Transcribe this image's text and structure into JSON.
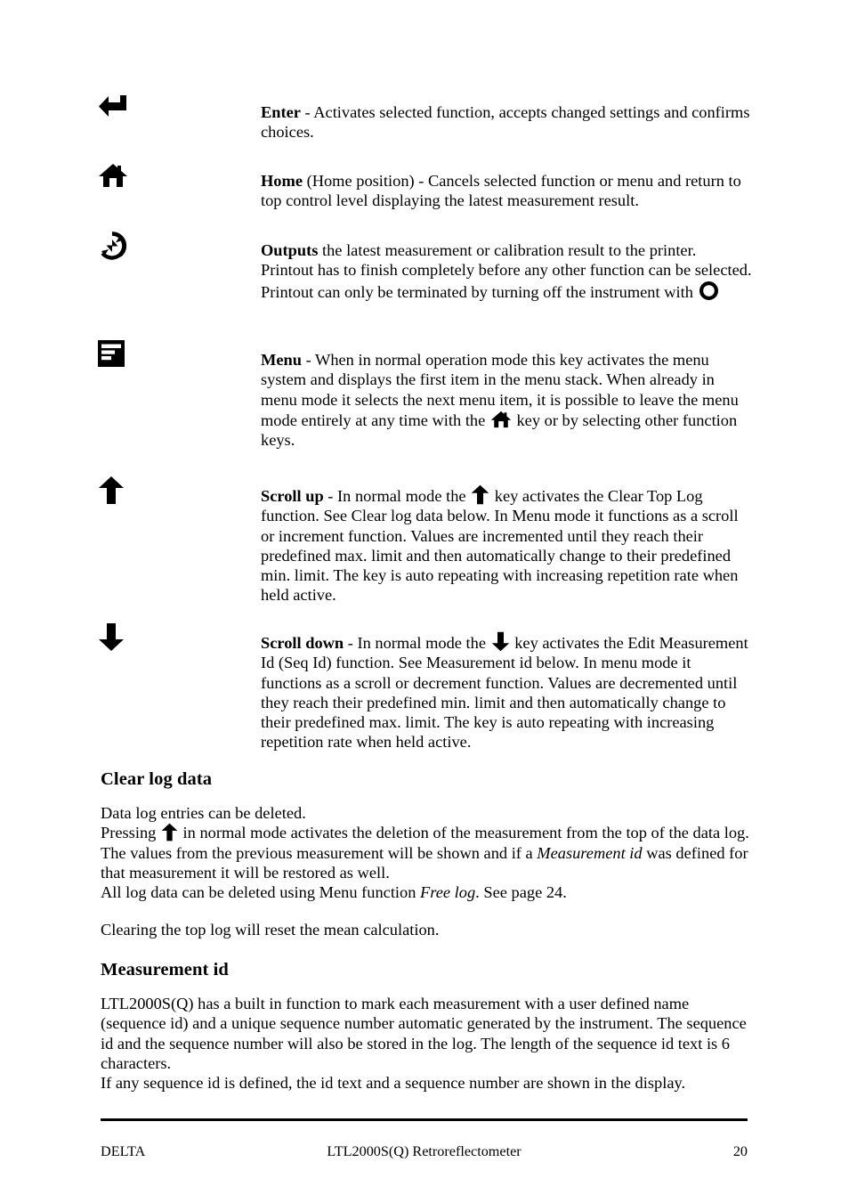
{
  "page": {
    "keys": [
      {
        "icon": "enter-arrow-icon",
        "term": "Enter",
        "text": " - Activates selected function, accepts changed settings and confirms choices."
      },
      {
        "icon": "home-icon",
        "term": "Home",
        "text": " (Home position) - Cancels selected function or menu and return to top control level displaying the latest measurement result."
      },
      {
        "icon": "print-output-circular-arrow-icon",
        "term": "Outputs",
        "text_part1": " the latest measurement or calibration result to the printer. Printout has to finish completely before any other function can be selected. Printout can only be terminated by turning off the instrument with ",
        "inline_icon": "power-circle-icon",
        "text_part2": ""
      },
      {
        "icon": "menu-list-icon",
        "term": "Menu",
        "text_part1": " - When in normal operation mode this key activates the menu system and displays the first item in the menu stack. When already in menu mode it selects the next menu item, it is possible to leave the menu mode entirely at any time with the ",
        "inline_icon": "home-icon",
        "text_part2": " key or by selecting other function keys."
      },
      {
        "icon": "arrow-up-icon",
        "term": "Scroll up",
        "text_part1": " - In normal mode the ",
        "inline_icon": "arrow-up-icon",
        "text_part2": " key activates the Clear Top Log function. See Clear log data below. In Menu mode it functions as a scroll or increment function. Values are incremented until they reach their predefined max. limit and then automatically change to their predefined min. limit. The key is auto repeating with increasing repetition rate when held active."
      },
      {
        "icon": "arrow-down-icon",
        "term": "Scroll down",
        "text_part1": " - In normal mode the ",
        "inline_icon": "arrow-down-icon",
        "text_part2": " key activates the Edit Measurement Id (Seq Id) function. See Measurement id below. In menu mode it functions as a scroll or decrement function. Values are decremented until they reach their predefined min. limit and then automatically change to their predefined max. limit. The key is auto repeating with increasing repetition rate when held active."
      }
    ],
    "clear_log": {
      "heading": "Clear log data",
      "line1": "Data log entries can be deleted.",
      "line2_a": "Pressing ",
      "line2_icon": "arrow-up-icon",
      "line2_b": " in normal mode activates the deletion of the measurement from the top of the data log. The values from the previous measurement will be shown and if a ",
      "line2_italic": "Measurement id",
      "line2_c": " was defined for that measurement it will be restored as well.",
      "line3_a": "All log data can be deleted using Menu function ",
      "line3_italic": "Free log",
      "line3_b": ". See page 24."
    },
    "clearing_note": "Clearing the top log will reset the mean calculation.",
    "measurement_id": {
      "heading": "Measurement id",
      "para1": "LTL2000S(Q) has a built in function to mark each measurement with a user defined name (sequence id) and a unique sequence number automatic generated by the instrument. The sequence id and the sequence number will also be stored in the log. The length of the sequence id text is 6 characters.",
      "para2": "If any sequence id is defined, the id text and a sequence number are shown in the display."
    },
    "footer": {
      "left": "DELTA",
      "center": "LTL2000S(Q) Retroreflectometer",
      "page_number": "20"
    },
    "colors": {
      "text": "#000000",
      "background": "#ffffff"
    }
  }
}
